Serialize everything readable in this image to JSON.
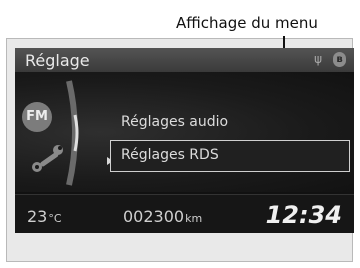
{
  "callout": {
    "label": "Affichage du menu"
  },
  "screen": {
    "title": "Réglage",
    "status_icons": [
      "usb-icon",
      "bluetooth-icon"
    ],
    "side_badge": "FM",
    "menu_items": [
      {
        "label": "Réglages audio",
        "selected": false
      },
      {
        "label": "Réglages RDS",
        "selected": true
      }
    ],
    "status_bar": {
      "temperature_value": "23",
      "temperature_unit": "°C",
      "odometer_value": "002300",
      "odometer_unit": "km",
      "clock": "12:34"
    }
  }
}
